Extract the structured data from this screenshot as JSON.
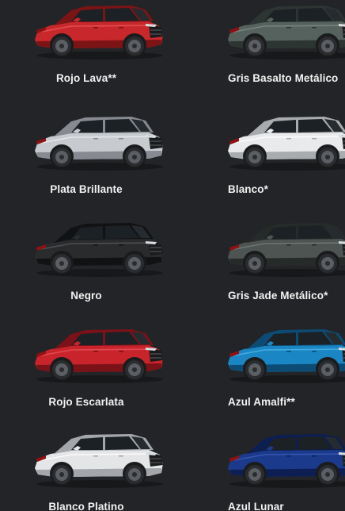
{
  "swatches": [
    {
      "label": "Rojo Lava**",
      "body_color": "#c8272b",
      "shade_color": "#7c1416",
      "highlight": "#e85a5a"
    },
    {
      "label": "Gris Basalto Metálico",
      "body_color": "#55625d",
      "shade_color": "#2d3532",
      "highlight": "#7f8c87"
    },
    {
      "label": "Plata Brillante",
      "body_color": "#c7cace",
      "shade_color": "#878b91",
      "highlight": "#eceef0"
    },
    {
      "label": "Blanco*",
      "body_color": "#e9eaeb",
      "shade_color": "#a9acaf",
      "highlight": "#ffffff"
    },
    {
      "label": "Negro",
      "body_color": "#2a2b2d",
      "shade_color": "#111213",
      "highlight": "#55575b"
    },
    {
      "label": "Gris Jade Metálico*",
      "body_color": "#4d5452",
      "shade_color": "#262b29",
      "highlight": "#757d7a"
    },
    {
      "label": "Rojo Escarlata",
      "body_color": "#c9242c",
      "shade_color": "#7a1218",
      "highlight": "#e4545a"
    },
    {
      "label": "Azul Amalfi**",
      "body_color": "#1a87c4",
      "shade_color": "#0c4c74",
      "highlight": "#4fb4e8"
    },
    {
      "label": "Blanco Platino",
      "body_color": "#e4e5e7",
      "shade_color": "#a3a6aa",
      "highlight": "#ffffff"
    },
    {
      "label": "Azul Lunar",
      "body_color": "#1b3a8c",
      "shade_color": "#0d1f52",
      "highlight": "#3d5cb8"
    }
  ]
}
